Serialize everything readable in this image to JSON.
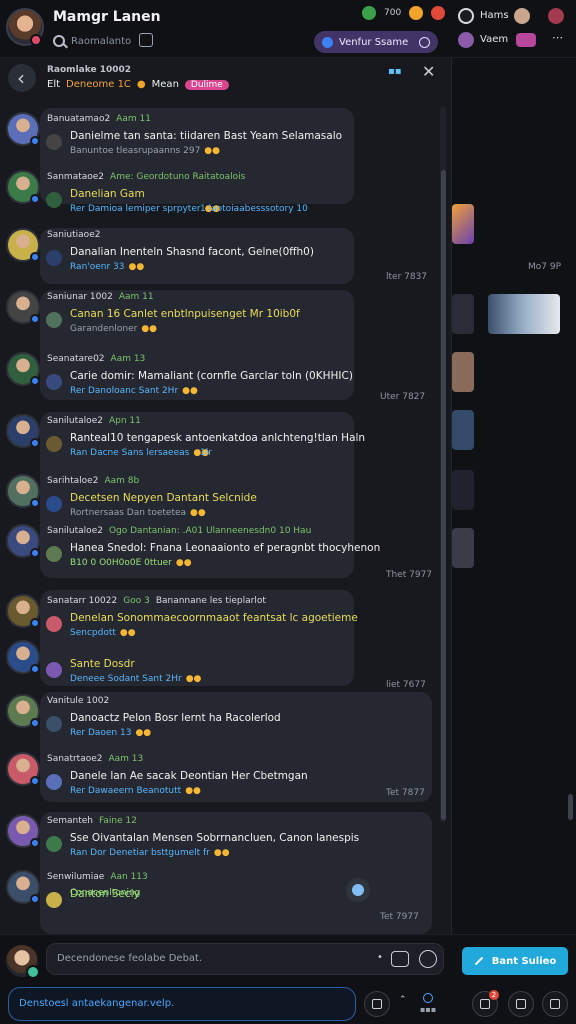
{
  "header": {
    "title": "Mamgr Lanen",
    "search_placeholder": "Raomalanto",
    "status_pill": "Venfur Ssame",
    "right_name_1": "Hams",
    "right_name_2": "Vaem",
    "counter": "700"
  },
  "thread": {
    "head_line1": "Raomlake 10002",
    "head_line2_a": "Elt",
    "head_line2_b": "Deneome 1C",
    "head_line2_c": "Mean",
    "head_badge": "Dulime"
  },
  "messages": [
    {
      "meta": "Banuatamao2",
      "meta2": "Aam 11",
      "body": "Danielme tan santa: tiidaren Bast Yeam Selamasalo",
      "sub": "Banuntoe tleasrupaanns 297",
      "sub_gray": true,
      "emoji": ""
    },
    {
      "meta": "Sanmataoe2",
      "meta2": "Ame: Geordotuno Raitatoalois",
      "body": "Danelian Gam",
      "sub": "Rer Damioa lemiper sprpyter",
      "sub_gray": false,
      "emoji": "1 laotoiaabesssotory 10",
      "body_color": "yel"
    },
    {
      "meta": "Saniutiaoe2",
      "meta2": "",
      "body": "Danalian Inenteln Shasnd facont, Gelne(0ffh0)",
      "sub": "Ran'oenr 33",
      "sub_gray": false,
      "emoji": ""
    },
    {
      "meta": "Saniunar 1002",
      "meta2": "Aam 11",
      "body": "Canan 16 Canlet enbtlnpuisenget Mr 10ib0f",
      "sub": "Garandenloner",
      "sub_gray": true,
      "emoji": "",
      "body_color": "yel"
    },
    {
      "meta": "Seanatare02",
      "meta2": "Aam 13",
      "body": "Carie domir: Mamaliant (cornfle Garclar toln (0KHHIC)",
      "sub": "Rer Danoloanc Sant 2Hr",
      "sub_gray": false,
      "emoji": ""
    },
    {
      "meta": "Sanilutaloe2",
      "meta2": "Apn 11",
      "body": "Ranteal10 tengapesk antoenkatdoa anlchteng!tlan Haln",
      "sub": "Ran Dacne Sans lersaeeas",
      "sub_gray": false,
      "emoji": "1lr"
    },
    {
      "meta": "Sarihtaloe2",
      "meta2": "Aam 8b",
      "body": "Decetsen Nepyen Dantant Selcnide",
      "sub": "Rortnersaas Dan toetetea",
      "sub_gray": true,
      "emoji": "",
      "body_color": "yel"
    },
    {
      "meta": "Sanilutaloe2",
      "meta2": "Ogo Dantanian: .A01 Ulanneenesdn0 10 Hau",
      "body": "Hanea Snedol: Fnana Leonaaionto ef peragnbt thocyhenon",
      "sub": "B10 0 O0H0o0E 0ttuer",
      "sub_gray": false,
      "emoji": "",
      "body_color": "",
      "sub_green": true
    },
    {
      "meta": "Sanatarr 10022",
      "meta2": "Goo 3",
      "body": "Denelan Sonommaecoornmaaot feantsat lc agoetieme",
      "sub": "Sencpdott",
      "sub_gray": false,
      "emoji": "",
      "body_color": "yel",
      "meta3": "Banannane les tieplarlot"
    },
    {
      "meta": "",
      "meta2": "",
      "body": "Sante Dosdr",
      "sub": "Deneee Sodant Sant 2Hr",
      "sub_gray": false,
      "emoji": "",
      "body_color": "yel"
    },
    {
      "meta": "Vanitule 1002",
      "meta2": "",
      "body": "Danoactz Pelon Bosr lernt ha Racolerlod",
      "sub": "Rer Daoen 13",
      "sub_gray": false,
      "emoji": ""
    },
    {
      "meta": "Sanatrtaoe2",
      "meta2": "Aam 13",
      "body": "Danele lan Ae sacak Deontian Her Cbetmgan",
      "sub": "Rer Dawaeern Beanotutt",
      "sub_gray": false,
      "emoji": ""
    },
    {
      "meta": "Semanteh",
      "meta2": "Faine 12",
      "body": "Sse Oivantalan Mensen Sobrrnancluen, Canon lanespis",
      "sub": "Ran Dor Denetiar bsttgumelt fr",
      "sub_gray": false,
      "emoji": ""
    },
    {
      "meta": "Senwilumiae",
      "meta2": "Aan 113",
      "body": "Danton Seciy",
      "sub": "",
      "sub_gray": false,
      "emoji": "Conacenltoning",
      "body_color": "grn"
    }
  ],
  "stamps": [
    "lter 7837",
    "Uter 7827",
    "Thet 7977",
    "liet 7677",
    "Tet 7877",
    "Tet 7977"
  ],
  "media": {
    "stamp": "Mo7 9P"
  },
  "composer": {
    "placeholder": "Decendonese feolabe Debat.",
    "send_label": "Bant Sulieo",
    "hint": "Denstoesl antaekangenar.velp.",
    "badge": "2"
  },
  "colors": {
    "accent": "#21a9dc",
    "status_pill_bg": "#433467",
    "bubble_bg": "#252830",
    "panel_bg": "#17191e",
    "verified": "#3b82f6"
  }
}
